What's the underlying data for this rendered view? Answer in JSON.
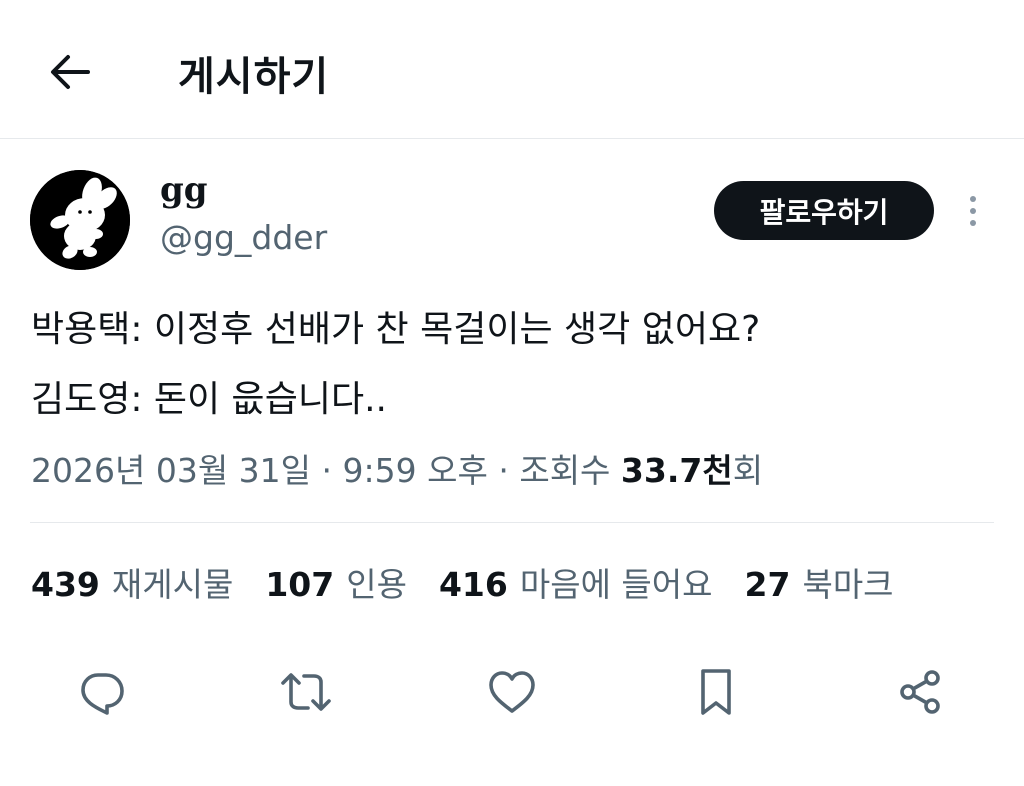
{
  "header": {
    "back_icon": "arrow-left-icon",
    "title": "게시하기"
  },
  "author": {
    "avatar_icon": "white-bunny-on-black-avatar",
    "display_name": "gg",
    "handle": "@gg_dder"
  },
  "follow_button": {
    "label": "팔로우하기"
  },
  "more_icon": "vertical-ellipsis-icon",
  "tweet": {
    "lines": [
      "박용택: 이정후 선배가 찬 목걸이는 생각 없어요?",
      "김도영: 돈이 읎습니다.."
    ]
  },
  "meta": {
    "date": "2026년 03월 31일",
    "separator": " · ",
    "time": "9:59 오후",
    "views_label_prefix": "조회수 ",
    "views_count": "33.7천",
    "views_label_suffix": "회"
  },
  "stats": [
    {
      "count": "439",
      "label": "재게시물"
    },
    {
      "count": "107",
      "label": "인용"
    },
    {
      "count": "416",
      "label": "마음에 들어요"
    },
    {
      "count": "27",
      "label": "북마크"
    }
  ],
  "actions": [
    {
      "icon": "reply-icon"
    },
    {
      "icon": "repost-icon"
    },
    {
      "icon": "like-icon"
    },
    {
      "icon": "bookmark-icon"
    },
    {
      "icon": "share-icon"
    }
  ],
  "colors": {
    "text_primary": "#0f1419",
    "text_secondary": "#536471",
    "divider": "#e6e9ec",
    "follow_bg": "#0f1419",
    "follow_text": "#ffffff"
  }
}
